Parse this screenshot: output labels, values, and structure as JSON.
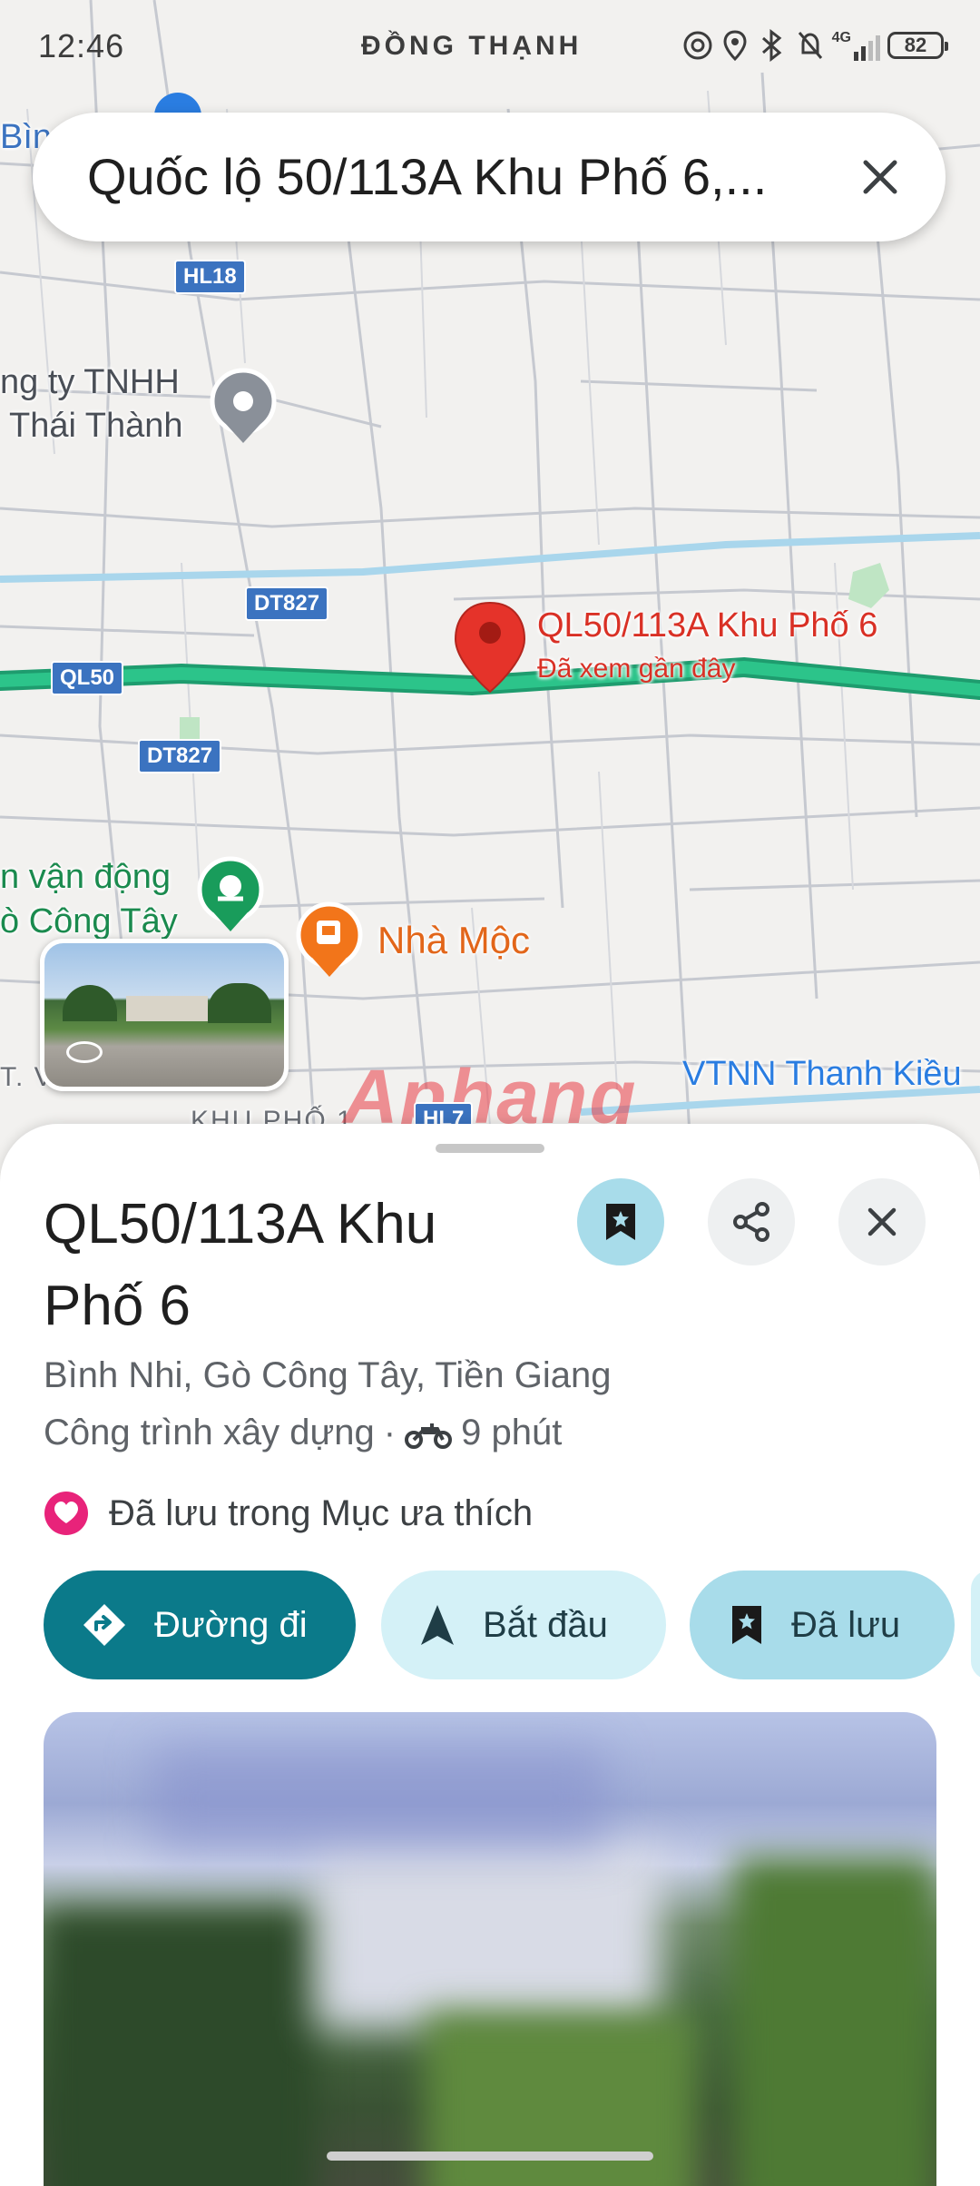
{
  "status_bar": {
    "time": "12:46",
    "location": "ĐỒNG THẠNH",
    "network": "4G",
    "battery": "82"
  },
  "search": {
    "query": "Quốc lộ 50/113A Khu Phố 6,..."
  },
  "map": {
    "labels": {
      "top_left": "Bìn",
      "company_line1": "ng ty TNHH",
      "company_line2": "Thái Thành",
      "pin_title": "QL50/113A Khu Phố 6",
      "pin_subtitle": "Đã xem gần đây",
      "sports_line1": "n vận động",
      "sports_line2": "ò Công Tây",
      "cafe": "Nhà Mộc",
      "vtnn": "VTNN Thanh Kiều",
      "khu_pho": "KHU PHỐ 1",
      "ward": "T. VĨNH BÌNH",
      "watermark": "Aphang"
    },
    "shields": {
      "hl18": "HL18",
      "dt827_a": "DT827",
      "ql50": "QL50",
      "dt827_b": "DT827",
      "hl7": "HL7"
    },
    "colors": {
      "route": "#2cc48a",
      "pin": "#e5332a",
      "water": "#a9d6ec"
    }
  },
  "place": {
    "title": "QL50/113A Khu Phố 6",
    "address": "Bình Nhi, Gò Công Tây, Tiền Giang",
    "category": "Công trình xây dựng",
    "separator": "·",
    "travel_time": "9 phút",
    "saved_text": "Đã lưu trong Mục ưa thích"
  },
  "actions": {
    "directions": "Đường đi",
    "start": "Bắt đầu",
    "saved": "Đã lưu"
  },
  "icons": {
    "search_clear": "close-icon",
    "save": "bookmark-icon",
    "share": "share-icon",
    "close": "close-icon",
    "travel": "motorbike-icon",
    "favorite": "heart-icon",
    "directions": "directions-icon",
    "start": "navigation-arrow-icon"
  }
}
